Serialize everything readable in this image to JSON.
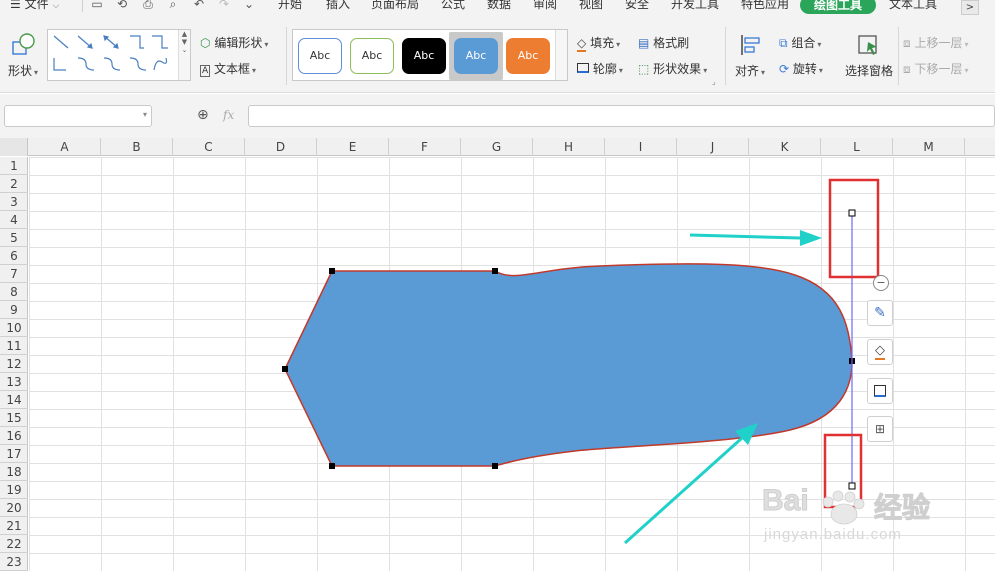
{
  "menu": {
    "file_label": "文件",
    "tabs": [
      "开始",
      "插入",
      "页面布局",
      "公式",
      "数据",
      "审阅",
      "视图",
      "安全",
      "开发工具",
      "特色应用"
    ],
    "active_tab": "绘图工具",
    "text_tool_tab": "文本工具",
    "more": ">"
  },
  "ribbon": {
    "shape_label": "形状",
    "edit_shape_label": "编辑形状",
    "textbox_label": "文本框",
    "style_swatches": [
      {
        "text": "Abc",
        "fill": "#ffffff",
        "border": "#5b8fd6",
        "color": "#333333"
      },
      {
        "text": "Abc",
        "fill": "#ffffff",
        "border": "#8cbf5a",
        "color": "#333333"
      },
      {
        "text": "Abc",
        "fill": "#000000",
        "border": "#000000",
        "color": "#ffffff"
      },
      {
        "text": "Abc",
        "fill": "#5b9bd5",
        "border": "#5b9bd5",
        "color": "#ffffff"
      },
      {
        "text": "Abc",
        "fill": "#ed7d31",
        "border": "#ed7d31",
        "color": "#ffffff"
      }
    ],
    "fill_label": "填充",
    "outline_label": "轮廓",
    "format_painter_label": "格式刷",
    "shape_effect_label": "形状效果",
    "align_label": "对齐",
    "group_label": "组合",
    "rotate_label": "旋转",
    "selection_pane_label": "选择窗格",
    "bring_forward_label": "上移一层",
    "send_backward_label": "下移一层"
  },
  "formula_bar": {
    "name_box_value": "",
    "fx_label": "fx",
    "formula_value": ""
  },
  "sheet": {
    "columns": [
      "A",
      "B",
      "C",
      "D",
      "E",
      "F",
      "G",
      "H",
      "I",
      "J",
      "K",
      "L",
      "M"
    ],
    "rows": [
      "1",
      "2",
      "3",
      "4",
      "5",
      "6",
      "7",
      "8",
      "9",
      "10",
      "11",
      "12",
      "13",
      "14",
      "15",
      "16",
      "17",
      "18",
      "19",
      "20",
      "21",
      "22",
      "23"
    ]
  },
  "shape": {
    "fill_color": "#5b9bd5",
    "outline_color": "#c0392b",
    "handle_line_color": "#6b6bff"
  },
  "annotations": {
    "highlight_color": "#e03030",
    "arrow_color": "#1fd1c8"
  },
  "floating_toolbar": {
    "icons": [
      "collapse-icon",
      "brush-icon",
      "fill-bucket-icon",
      "outline-icon",
      "layout-icon"
    ]
  },
  "watermark": {
    "brand_text": "Bai",
    "brand_cn": "经验",
    "url": "jingyan.baidu.com"
  }
}
